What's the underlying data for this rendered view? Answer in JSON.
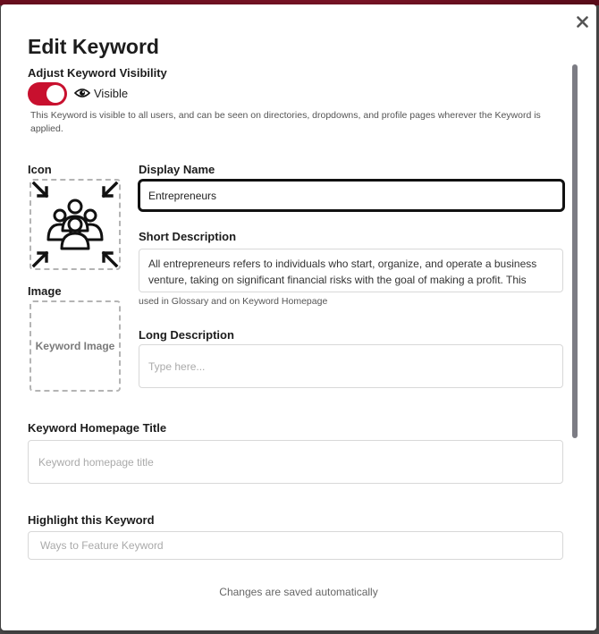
{
  "modal": {
    "title": "Edit Keyword",
    "close_icon": "close-icon"
  },
  "visibility": {
    "label": "Adjust Keyword Visibility",
    "toggle_on": true,
    "toggle_color": "#c8102e",
    "status_icon": "eye-icon",
    "status_text": "Visible",
    "help_text": "This Keyword is visible to all users, and can be seen on directories, dropdowns, and profile pages wherever the Keyword is applied."
  },
  "icon_section": {
    "label": "Icon",
    "icon": "group-of-people-icon"
  },
  "image_section": {
    "label": "Image",
    "placeholder": "Keyword Image"
  },
  "display_name": {
    "label": "Display Name",
    "value": "Entrepreneurs"
  },
  "short_description": {
    "label": "Short Description",
    "value": "All entrepreneurs refers to individuals who start, organize, and operate a business venture, taking on significant financial risks with the goal of making a profit. This",
    "help": "used in Glossary and on Keyword Homepage"
  },
  "long_description": {
    "label": "Long Description",
    "placeholder": "Type here..."
  },
  "homepage_title": {
    "label": "Keyword Homepage Title",
    "placeholder": "Keyword homepage title"
  },
  "highlight": {
    "label": "Highlight this Keyword",
    "placeholder": "Ways to Feature Keyword"
  },
  "footer": {
    "status": "Changes are saved automatically"
  }
}
